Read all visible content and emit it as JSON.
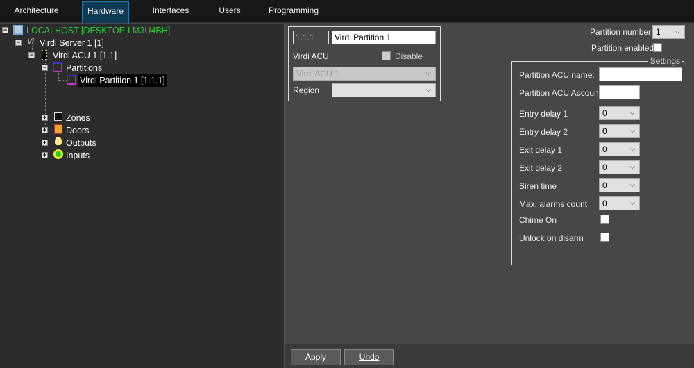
{
  "tabs": [
    {
      "label": "Architecture"
    },
    {
      "label": "Hardware"
    },
    {
      "label": "Interfaces"
    },
    {
      "label": "Users"
    },
    {
      "label": "Programming"
    }
  ],
  "tree": {
    "root": "LOCALHOST [DESKTOP-LM3U4BH]",
    "server": "Virdi Server 1 [1]",
    "acu": "Virdi ACU 1 [1.1]",
    "partitions": "Partitions",
    "partition": "Virdi Partition 1 [1.1.1]",
    "zones": "Zones",
    "doors": "Doors",
    "outputs": "Outputs",
    "inputs": "Inputs"
  },
  "form": {
    "id": "1.1.1",
    "name": "Virdi Partition 1",
    "acu_label": "Virdi ACU",
    "disable_label": "Disable",
    "acu_value": "Virdi ACU 1",
    "region_label": "Region",
    "region_value": ""
  },
  "partition_number_label": "Partition number",
  "partition_number": "1",
  "partition_enabled_label": "Partition enabled",
  "settings": {
    "title": "Settings",
    "acu_name_label": "Partition ACU name:",
    "acu_name": "",
    "acu_account_label": "Partition ACU Account:",
    "acu_account": "",
    "rows": [
      {
        "label": "Entry delay 1",
        "value": "0"
      },
      {
        "label": "Entry delay 2",
        "value": "0"
      },
      {
        "label": "Exit delay 1",
        "value": "0"
      },
      {
        "label": "Exit delay 2",
        "value": "0"
      },
      {
        "label": "Siren time",
        "value": "0"
      },
      {
        "label": "Max. alarms count",
        "value": "0"
      }
    ],
    "chime_label": "Chime On",
    "unlock_label": "Unlock on disarm"
  },
  "buttons": {
    "apply": "Apply",
    "undo": "Undo"
  }
}
